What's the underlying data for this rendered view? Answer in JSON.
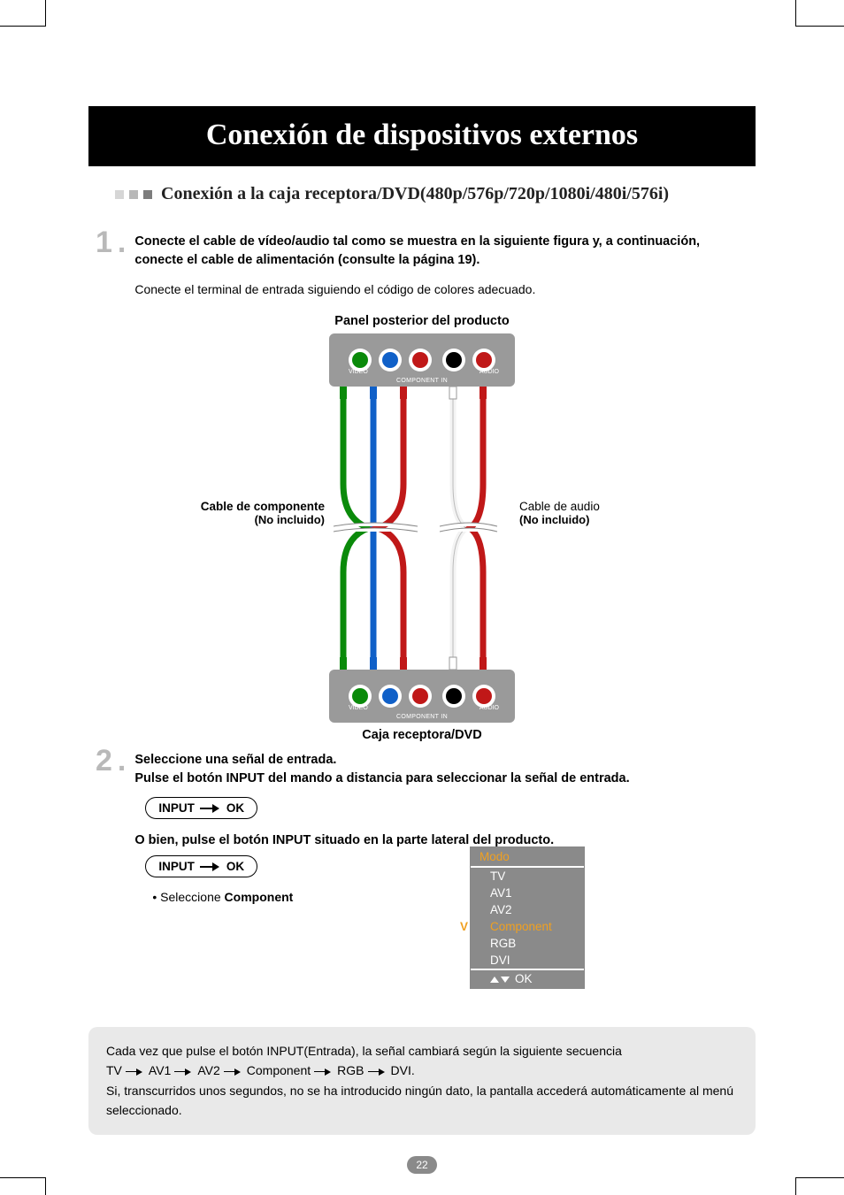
{
  "title": "Conexión de dispositivos externos",
  "subtitle": "Conexión a la caja receptora/DVD(480p/576p/720p/1080i/480i/576i)",
  "step1": {
    "num": "1",
    "bold": "Conecte el cable de vídeo/audio tal como se muestra en la siguiente figura y, a continuación, conecte el cable de alimentación (consulte la página 19).",
    "sub": "Conecte el terminal de entrada siguiendo el código de colores adecuado."
  },
  "diagram": {
    "top_panel_label": "Panel posterior del producto",
    "video_label": "VIDEO",
    "audio_label": "AUDIO",
    "component_label": "COMPONENT IN",
    "cable_left_1": "Cable de componente",
    "cable_left_2": "(No incluido)",
    "cable_right_1": "Cable de audio",
    "cable_right_2": "(No incluido)",
    "bottom_device_label": "Caja receptora/DVD"
  },
  "step2": {
    "num": "2",
    "line1": "Seleccione una señal de entrada.",
    "line2": "Pulse el botón INPUT del mando a distancia para seleccionar la señal de entrada.",
    "input": "INPUT",
    "ok": "OK",
    "line3": "O bien, pulse el botón INPUT situado en la parte lateral del producto.",
    "select_prefix": "• Seleccione ",
    "select_value": "Component"
  },
  "modo": {
    "title": "Modo",
    "items": [
      "TV",
      "AV1",
      "AV2",
      "Component",
      "RGB",
      "DVI"
    ],
    "selected_index": 3,
    "ok": "OK"
  },
  "note": {
    "l1": "Cada vez que pulse el botón INPUT(Entrada), la señal cambiará según la siguiente secuencia",
    "seq": [
      "TV",
      "AV1",
      "AV2",
      "Component",
      "RGB",
      "DVI."
    ],
    "l2": "Si, transcurridos unos segundos, no se ha introducido ningún dato, la pantalla accederá automáticamente al menú seleccionado."
  },
  "page_number": "22"
}
